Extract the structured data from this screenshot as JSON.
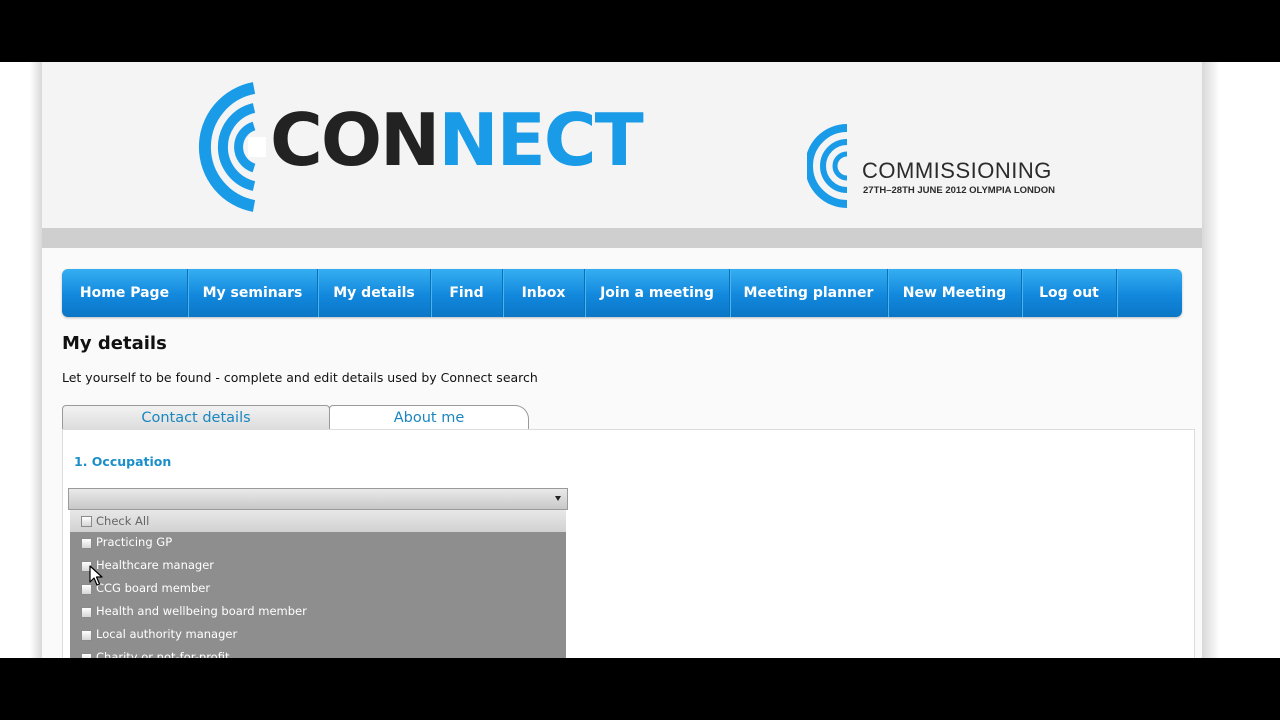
{
  "brand": {
    "logo_text_dark": "CON",
    "logo_text_blue": "NECT",
    "event_title": "COMMISSIONING",
    "event_subtitle": "27TH–28TH JUNE 2012 OLYMPIA LONDON",
    "colors": {
      "accent": "#1a9be8",
      "dark": "#222222",
      "nav": "#1288dc"
    }
  },
  "nav": {
    "items": [
      {
        "label": "Home Page"
      },
      {
        "label": "My seminars"
      },
      {
        "label": "My details"
      },
      {
        "label": "Find"
      },
      {
        "label": "Inbox"
      },
      {
        "label": "Join a meeting"
      },
      {
        "label": "Meeting planner"
      },
      {
        "label": "New Meeting"
      },
      {
        "label": "Log out"
      }
    ]
  },
  "page": {
    "title": "My details",
    "subtitle": "Let yourself to be found - complete and edit details used by Connect search"
  },
  "tabs": [
    {
      "label": "Contact details",
      "active": false
    },
    {
      "label": "About me",
      "active": true
    }
  ],
  "occupation": {
    "section_label": "1. Occupation",
    "selected_value": "",
    "options": [
      {
        "label": "Check All",
        "checked": false
      },
      {
        "label": "Practicing GP",
        "checked": false
      },
      {
        "label": "Healthcare manager",
        "checked": false
      },
      {
        "label": "CCG board member",
        "checked": false
      },
      {
        "label": "Health and wellbeing board member",
        "checked": false
      },
      {
        "label": "Local authority manager",
        "checked": false
      },
      {
        "label": "Charity or not-for-profit",
        "checked": false
      }
    ]
  }
}
